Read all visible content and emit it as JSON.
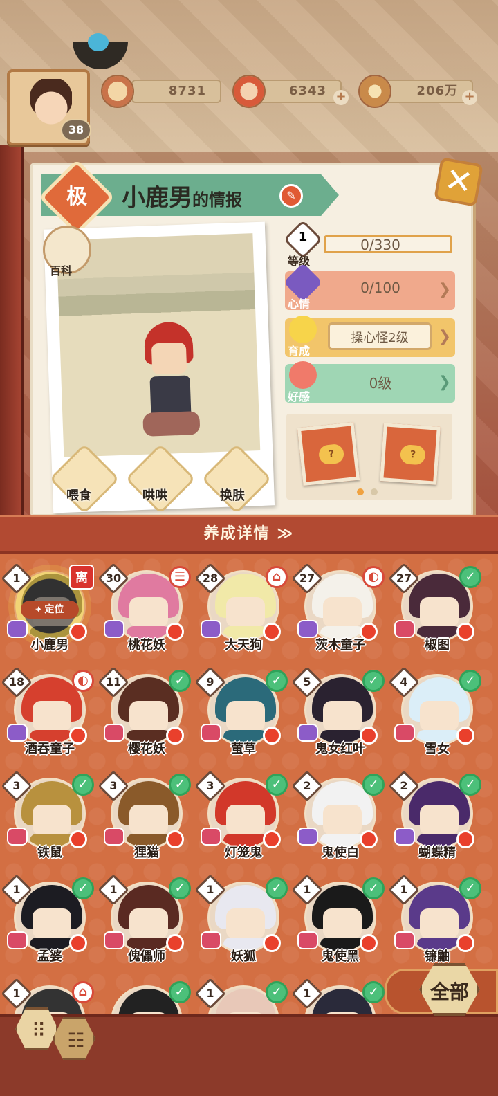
{
  "resources": {
    "player_level": "38",
    "currency1": "8731",
    "currency2": "6343",
    "currency3": "206万"
  },
  "info": {
    "rarity": "极",
    "name": "小鹿男",
    "title_suffix": "的情报",
    "wiki_label": "百科"
  },
  "stats": {
    "level_num": "1",
    "level_value": "0/330",
    "level_label": "等级",
    "mood_value": "0/100",
    "mood_label": "心情",
    "growth_value": "操心怪2级",
    "growth_label": "育成",
    "favor_value": "0级",
    "favor_label": "好感"
  },
  "actions": [
    "喂食",
    "哄哄",
    "换肤"
  ],
  "detail_bar": {
    "label": "养成详情 ≫"
  },
  "characters": [
    {
      "name": "小鹿男",
      "level": "1",
      "mark": "离",
      "selected": true,
      "locate": "定位",
      "heart": "purple",
      "hair": "#222"
    },
    {
      "name": "桃花妖",
      "level": "30",
      "mark": "☰",
      "heart": "purple",
      "hair": "#e07aa0"
    },
    {
      "name": "大天狗",
      "level": "28",
      "mark": "⌂",
      "heart": "purple",
      "hair": "#f1e9a8"
    },
    {
      "name": "茨木童子",
      "level": "27",
      "mark": "◐",
      "heart": "purple",
      "hair": "#f4f1ea"
    },
    {
      "name": "椒图",
      "level": "27",
      "mark": "✓",
      "heart": "red",
      "hair": "#4a2a3a"
    },
    {
      "name": "酒吞童子",
      "level": "18",
      "mark": "◐",
      "heart": "purple",
      "hair": "#d6402e"
    },
    {
      "name": "樱花妖",
      "level": "11",
      "mark": "✓",
      "heart": "red",
      "hair": "#5a2e22"
    },
    {
      "name": "萤草",
      "level": "9",
      "mark": "✓",
      "heart": "red",
      "hair": "#2b6a7a"
    },
    {
      "name": "鬼女红叶",
      "level": "5",
      "mark": "✓",
      "heart": "purple",
      "hair": "#2a2230"
    },
    {
      "name": "雪女",
      "level": "4",
      "mark": "✓",
      "heart": "red",
      "hair": "#dbeef8"
    },
    {
      "name": "铁鼠",
      "level": "3",
      "mark": "✓",
      "heart": "red",
      "hair": "#b8913e"
    },
    {
      "name": "狸猫",
      "level": "3",
      "mark": "✓",
      "heart": "red",
      "hair": "#8a5a2a"
    },
    {
      "name": "灯笼鬼",
      "level": "3",
      "mark": "✓",
      "heart": "red",
      "hair": "#d2382a"
    },
    {
      "name": "鬼使白",
      "level": "2",
      "mark": "✓",
      "heart": "purple",
      "hair": "#f2f2f2"
    },
    {
      "name": "蝴蝶精",
      "level": "2",
      "mark": "✓",
      "heart": "purple",
      "hair": "#4a2a6a"
    },
    {
      "name": "孟婆",
      "level": "1",
      "mark": "✓",
      "heart": "red",
      "hair": "#1c1c22"
    },
    {
      "name": "傀儡师",
      "level": "1",
      "mark": "✓",
      "heart": "red",
      "hair": "#5a2a22"
    },
    {
      "name": "妖狐",
      "level": "1",
      "mark": "✓",
      "heart": "red",
      "hair": "#e8e8f0"
    },
    {
      "name": "鬼使黑",
      "level": "1",
      "mark": "✓",
      "heart": "red",
      "hair": "#1a1a1a"
    },
    {
      "name": "镰鼬",
      "level": "1",
      "mark": "✓",
      "heart": "red",
      "hair": "#5a3a8a"
    },
    {
      "name": "",
      "level": "1",
      "mark": "⌂",
      "heart": "red",
      "hair": "#333"
    },
    {
      "name": "",
      "level": "",
      "mark": "✓",
      "heart": "red",
      "hair": "#222"
    },
    {
      "name": "",
      "level": "1",
      "mark": "✓",
      "heart": "red",
      "hair": "#e8c8b8"
    },
    {
      "name": "",
      "level": "1",
      "mark": "✓",
      "heart": "red",
      "hair": "#2a2a3a"
    },
    {
      "name": "",
      "level": "",
      "mark": "",
      "heart": "red",
      "hair": "#fff"
    }
  ],
  "filter": {
    "all_label": "全部"
  }
}
